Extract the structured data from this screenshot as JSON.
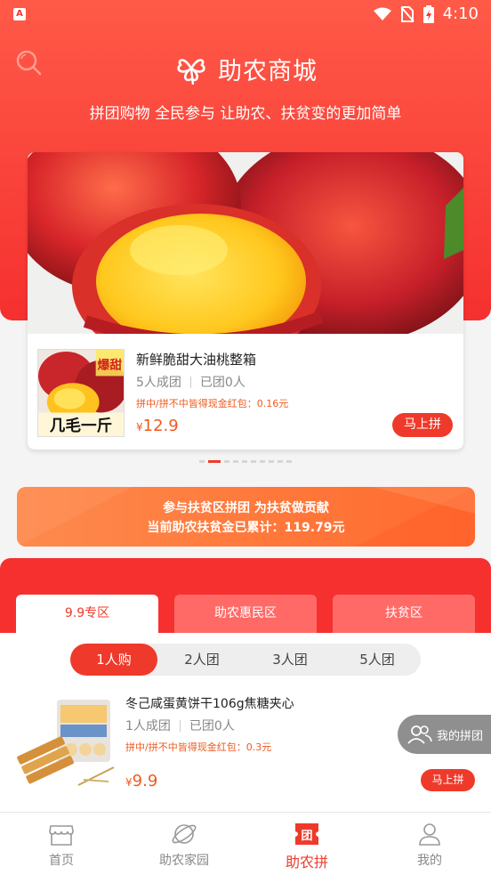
{
  "status_bar": {
    "time": "4:10",
    "app_badge": "A"
  },
  "header": {
    "title": "助农商城",
    "subtitle": "拼团购物 全民参与 让助农、扶贫变的更加简单"
  },
  "featured_product": {
    "thumb_badge": "爆甜",
    "thumb_caption": "几毛一斤",
    "title": "新鲜脆甜大油桃整箱",
    "group_size": "5人成团",
    "joined": "已团0人",
    "bonus": "拼中/拼不中皆得现金红包：0.16元",
    "currency": "¥",
    "price": "12.9",
    "button": "马上拼"
  },
  "carousel": {
    "count": 10,
    "active_index": 1
  },
  "promo": {
    "line1": "参与扶贫区拼团 为扶贫做贡献",
    "line2": "当前助农扶贫金已累计：119.79元"
  },
  "zones": {
    "tabs": [
      "9.9专区",
      "助农惠民区",
      "扶贫区"
    ],
    "active_tab": 0,
    "subtabs": [
      "1人购",
      "2人团",
      "3人团",
      "5人团"
    ],
    "active_subtab": 0
  },
  "list_item": {
    "title": "冬己咸蛋黄饼干106g焦糖夹心",
    "group_size": "1人成团",
    "joined": "已团0人",
    "bonus": "拼中/拼不中皆得现金红包：0.3元",
    "currency": "¥",
    "price": "9.9",
    "button": "马上拼"
  },
  "floating_button": {
    "label": "我的拼团"
  },
  "bottom_nav": {
    "items": [
      "首页",
      "助农家园",
      "助农拼",
      "我的"
    ],
    "active": 2
  },
  "colors": {
    "primary": "#ef3a2b",
    "accent_orange": "#ff7a3c",
    "price": "#ef5a1e"
  }
}
